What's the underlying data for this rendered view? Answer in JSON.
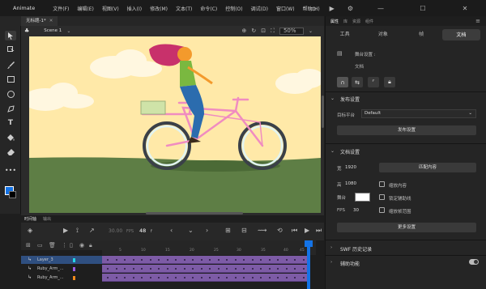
{
  "app": {
    "name": "Animate",
    "menu": [
      "文件(F)",
      "编辑(E)",
      "视图(V)",
      "插入(I)",
      "修改(M)",
      "文本(T)",
      "命令(C)",
      "控制(O)",
      "调试(D)",
      "窗口(W)",
      "帮助(H)"
    ]
  },
  "document": {
    "tab_label": "无标题-1",
    "tab_modified": "*"
  },
  "stage": {
    "scene_label": "Scene 1",
    "zoom": "50%",
    "sky_color": "#ffe9a8",
    "ground_color": "#5e7e45",
    "canvas_border": "#333333"
  },
  "colors": {
    "accent": "#1473e6",
    "stroke_swatch": "#1473e6",
    "fill_swatch": "#000000",
    "frame_span": "#7d5ba6"
  },
  "right_panel": {
    "panel_tabs": [
      "属性",
      "库",
      "资源",
      "组件"
    ],
    "prop_tabs": [
      "工具",
      "对象",
      "帧",
      "文档"
    ],
    "active_prop_tab": "文档",
    "document_label": "舞台设置 :",
    "document_sublabel": "文档",
    "publish_section_title": "发布设置",
    "target_label": "目标平台",
    "target_value": "Default",
    "publish_button": "发布设置",
    "doc_section_title": "文档设置",
    "width_label": "宽",
    "width_value": "1920",
    "height_label": "高",
    "height_value": "1080",
    "match_button": "匹配内容",
    "scale_content": "缩放内容",
    "stage_label": "舞台",
    "fps_label": "FPS",
    "fps_value": "30",
    "scale_to_fit": "锁定辅助线",
    "span_based": "缩放帧范围",
    "more_settings_button": "更多设置",
    "swf_history": "SWF 历史记录",
    "accessibility": "辅助功能"
  },
  "timeline": {
    "panel_title": "时间轴",
    "output_tab": "输出",
    "fps_display": "30.00",
    "fps_unit": "FPS",
    "current_frame": "48",
    "frame_unit": "f",
    "ruler_ticks": [
      "5",
      "10",
      "15",
      "20",
      "25",
      "30",
      "35",
      "40",
      "45"
    ],
    "layers": [
      {
        "name": "Layer_3",
        "color": "#23d4e8",
        "selected": true
      },
      {
        "name": "Ruby_Arm_...",
        "color": "#9a5be0",
        "selected": false
      },
      {
        "name": "Ruby_Arm_...",
        "color": "#f08a1c",
        "selected": false
      }
    ]
  },
  "icons": {
    "toolbar": [
      "selection-tool-icon",
      "subselection-tool-icon",
      "paintbrush-tool-icon",
      "rectangle-tool-icon",
      "oval-tool-icon",
      "pen-tool-icon",
      "text-tool-icon",
      "paint-bucket-tool-icon",
      "eraser-tool-icon",
      "more-tools-icon"
    ],
    "window": [
      "minimize-icon",
      "maximize-icon",
      "close-icon"
    ]
  }
}
